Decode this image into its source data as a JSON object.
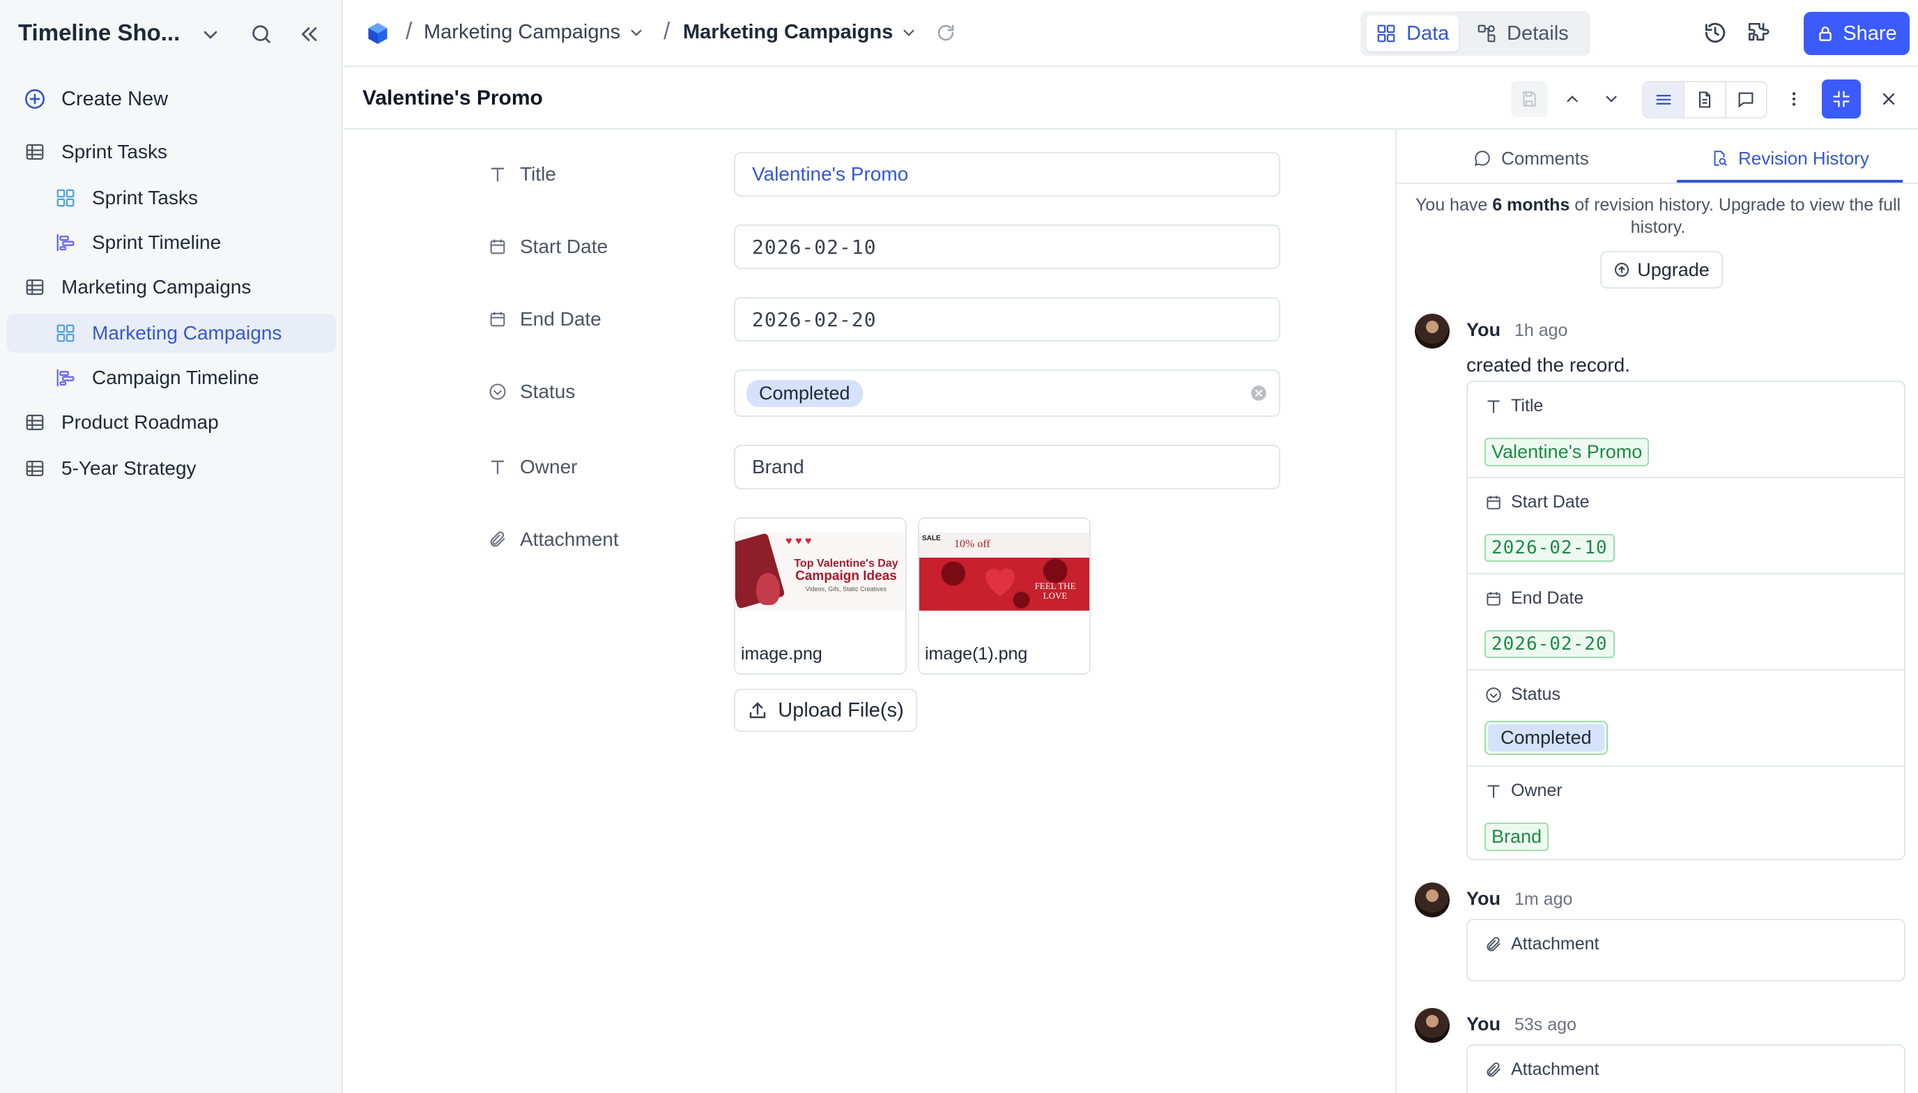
{
  "sidebar": {
    "workspace_title": "Timeline Sho...",
    "create_new": "Create New",
    "items": [
      {
        "label": "Sprint Tasks",
        "type": "table",
        "level": 0
      },
      {
        "label": "Sprint Tasks",
        "type": "grid-view",
        "level": 1
      },
      {
        "label": "Sprint Timeline",
        "type": "timeline-view",
        "level": 1
      },
      {
        "label": "Marketing Campaigns",
        "type": "table",
        "level": 0
      },
      {
        "label": "Marketing Campaigns",
        "type": "grid-view",
        "level": 1,
        "active": true
      },
      {
        "label": "Campaign Timeline",
        "type": "timeline-view",
        "level": 1
      },
      {
        "label": "Product Roadmap",
        "type": "table",
        "level": 0
      },
      {
        "label": "5-Year Strategy",
        "type": "table",
        "level": 0
      }
    ]
  },
  "topbar": {
    "breadcrumb": [
      "Marketing Campaigns",
      "Marketing Campaigns"
    ],
    "tabs": [
      {
        "label": "Data",
        "active": true
      },
      {
        "label": "Details",
        "active": false
      }
    ],
    "share_label": "Share",
    "accent": "#3b5bfd"
  },
  "record": {
    "title": "Valentine's Promo"
  },
  "form": {
    "fields": [
      {
        "label": "Title",
        "value": "Valentine's Promo",
        "icon": "text-icon"
      },
      {
        "label": "Start Date",
        "value": "2026-02-10",
        "icon": "calendar-icon"
      },
      {
        "label": "End Date",
        "value": "2026-02-20",
        "icon": "calendar-icon"
      },
      {
        "label": "Status",
        "value": "Completed",
        "icon": "status-icon"
      },
      {
        "label": "Owner",
        "value": "Brand",
        "icon": "text-icon"
      },
      {
        "label": "Attachment",
        "icon": "paperclip-icon"
      }
    ],
    "attachments": [
      {
        "name": "image.png",
        "thumb_title_line1": "Top Valentine's Day",
        "thumb_title_line2": "Campaign Ideas",
        "thumb_subtitle": "Videos, Gifs, Static Creatives"
      },
      {
        "name": "image(1).png",
        "thumb_sale": "SALE",
        "thumb_discount": "10% off",
        "thumb_caption_line1": "FEEL THE",
        "thumb_caption_line2": "LOVE"
      }
    ],
    "upload_label": "Upload File(s)"
  },
  "panel": {
    "tabs": [
      {
        "label": "Comments",
        "active": false
      },
      {
        "label": "Revision History",
        "active": true
      }
    ],
    "notice_before": "You have ",
    "notice_bold": "6 months",
    "notice_after": " of revision history. Upgrade to view the full history.",
    "upgrade_label": "Upgrade",
    "revisions": [
      {
        "user": "You",
        "time": "1h ago",
        "action": "created the record.",
        "changes": [
          {
            "field": "Title",
            "value": "Valentine's Promo"
          },
          {
            "field": "Start Date",
            "value": "2026-02-10"
          },
          {
            "field": "End Date",
            "value": "2026-02-20"
          },
          {
            "field": "Status",
            "value": "Completed"
          },
          {
            "field": "Owner",
            "value": "Brand"
          }
        ]
      },
      {
        "user": "You",
        "time": "1m ago",
        "changes": [
          {
            "field": "Attachment"
          }
        ]
      },
      {
        "user": "You",
        "time": "53s ago",
        "changes": [
          {
            "field": "Attachment"
          }
        ]
      }
    ]
  }
}
